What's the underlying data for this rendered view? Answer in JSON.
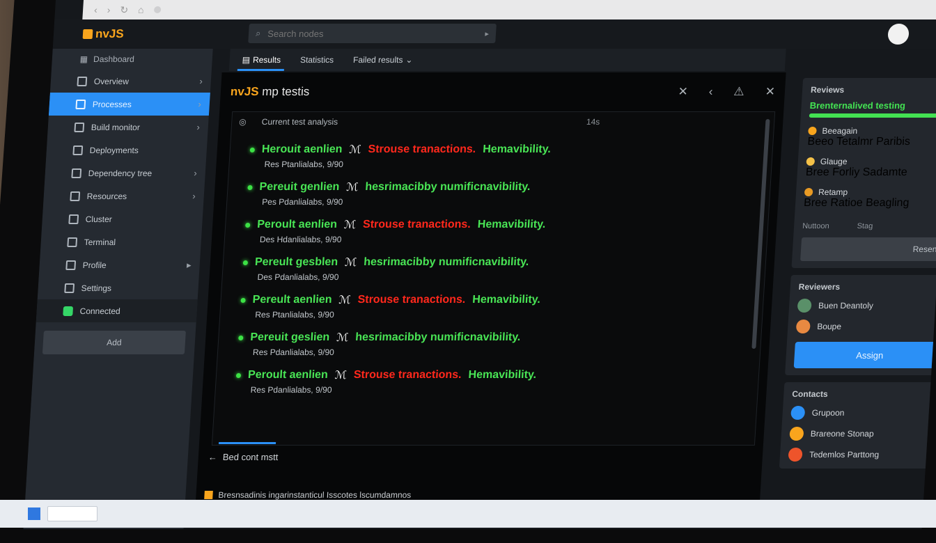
{
  "browser": {
    "controls": [
      "‹",
      "›",
      "↻",
      "⌂"
    ]
  },
  "app": {
    "brand": "nvJS",
    "search_placeholder": "Search nodes",
    "avatar_icon": "user-avatar"
  },
  "sidebar": {
    "top_label": "Dashboard",
    "items": [
      {
        "label": "Overview",
        "icon": "grid-icon"
      },
      {
        "label": "Processes",
        "icon": "list-icon"
      },
      {
        "label": "Build monitor",
        "icon": "monitor-icon"
      },
      {
        "label": "Deployments",
        "icon": "rocket-icon"
      },
      {
        "label": "Dependency tree",
        "icon": "tree-icon"
      },
      {
        "label": "Resources",
        "icon": "box-icon"
      },
      {
        "label": "Cluster",
        "icon": "cluster-icon"
      },
      {
        "label": "Terminal",
        "icon": "terminal-icon"
      },
      {
        "label": "Profile",
        "icon": "user-icon"
      },
      {
        "label": "Settings",
        "icon": "gear-icon"
      }
    ],
    "status_label": "Connected",
    "button_label": "Add",
    "foot_left": "◂",
    "foot_right": "▸"
  },
  "tabs": [
    {
      "label": "Results"
    },
    {
      "label": "Statistics"
    },
    {
      "label": "Failed results"
    }
  ],
  "panel": {
    "title_brand": "nvJS",
    "title_rest": " mp testis",
    "actions": [
      "✕",
      "‹",
      "⚠",
      "✕"
    ],
    "log_header_icon": "◎",
    "log_header_label": "Current test analysis",
    "log_header_right": "14s",
    "entries": [
      {
        "head": "Herouit aenlien",
        "sym": "ℳ",
        "c1": "Strouse tranactions.",
        "c2": "Hemavibility.",
        "c1_color": "#ff2a1f",
        "sub": "Res Ptanlialabs, 9/90"
      },
      {
        "head": "Pereuit genlien",
        "sym": "ℳ",
        "c1": "hesrimacibby numificnavibility.",
        "c2": "",
        "c1_color": "#4ee35a",
        "sub": "Pes Pdanlialabs, 9/90"
      },
      {
        "head": "Peroult aenlien",
        "sym": "ℳ",
        "c1": "Strouse tranactions.",
        "c2": "Hemavibility.",
        "c1_color": "#ff2a1f",
        "sub": "Des Hdanlialabs, 9/90"
      },
      {
        "head": "Pereult gesblen",
        "sym": "ℳ",
        "c1": "hesrimacibby numificnavibility.",
        "c2": "",
        "c1_color": "#4ee35a",
        "sub": "Des Pdanlialabs, 9/90"
      },
      {
        "head": "Pereult aenlien",
        "sym": "ℳ",
        "c1": "Strouse tranactions.",
        "c2": "Hemavibility.",
        "c1_color": "#ff2a1f",
        "sub": "Res Ptanlialabs, 9/90"
      },
      {
        "head": "Pereuit geslien",
        "sym": "ℳ",
        "c1": "hesrimacibby numificnavibility.",
        "c2": "",
        "c1_color": "#4ee35a",
        "sub": "Res Pdanlialabs, 9/90"
      },
      {
        "head": "Peroult aenlien",
        "sym": "ℳ",
        "c1": "Strouse tranactions.",
        "c2": "Hemavibility.",
        "c1_color": "#ff2a1f",
        "sub": "Res Pdanlialabs, 9/90"
      }
    ],
    "footer_back": "←",
    "footer_label": "Bed cont mstt",
    "status_text": "Bresnsadinis ingarinstanticul Isscotes lscumdamnos"
  },
  "right": {
    "card1": {
      "title": "Reviews",
      "progress_label": "Brenternalived testing",
      "progress": 0.92,
      "items": [
        {
          "name": "Beeagain",
          "sub": "Beeo Tetalmr Paribis",
          "color": "#f5a524"
        },
        {
          "name": "Glauge",
          "sub": "Bree Forliy Sadamte",
          "color": "#f2c14e"
        },
        {
          "name": "Retamp",
          "sub": "Bree Ratioe Beagling",
          "color": "#e59a2a"
        }
      ],
      "meta_left": "Nuttoon",
      "meta_right": "Stag",
      "button": "Resend"
    },
    "card2": {
      "title": "Reviewers",
      "items": [
        {
          "name": "Buen Deantoly",
          "color": "#5c8f6a"
        },
        {
          "name": "Boupe",
          "color": "#e48a45"
        }
      ],
      "button": "Assign"
    },
    "card3": {
      "title": "Contacts",
      "items": [
        {
          "name": "Grupoon",
          "color": "#2f8ff0"
        },
        {
          "name": "Brareone Stonap",
          "color": "#f5a524"
        },
        {
          "name": "Tedemlos Parttong",
          "color": "#e8552e"
        }
      ]
    }
  }
}
